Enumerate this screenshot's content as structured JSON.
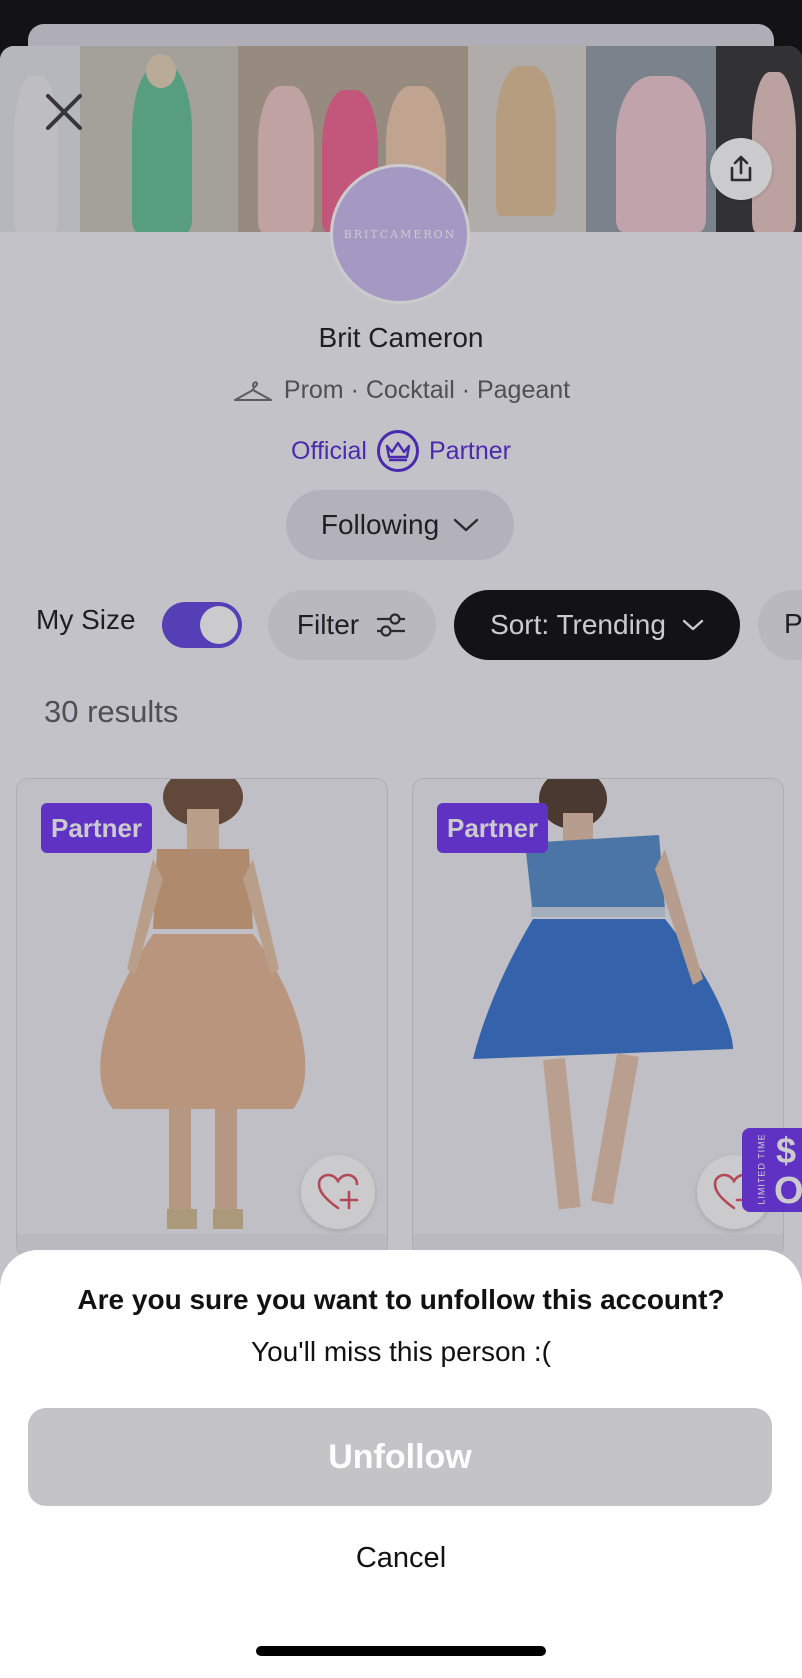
{
  "header": {
    "close_icon": "close-icon",
    "share_icon": "share-icon"
  },
  "profile": {
    "avatar_text": "BRITCAMERON",
    "avatar_color": "#cbb9f0",
    "name": "Brit Cameron",
    "categories": "Prom · Cocktail · Pageant",
    "hanger_icon": "hanger-icon",
    "official_label": "Official",
    "partner_label": "Partner",
    "crown_icon": "crown-icon",
    "accent_color": "#4b1fd1",
    "following_label": "Following"
  },
  "filters": {
    "my_size_label": "My Size",
    "my_size_on": true,
    "filter_label": "Filter",
    "sort_label": "Sort: Trending",
    "price_label": "Pr"
  },
  "results": {
    "count_label": "30 results"
  },
  "products": [
    {
      "badge": "Partner",
      "dress_color": "#e5b48e"
    },
    {
      "badge": "Partner",
      "dress_color": "#2f6fd0"
    }
  ],
  "promo": {
    "limited": "LIMITED TIME",
    "dollar": "$",
    "zero": "O"
  },
  "dialog": {
    "title": "Are you sure you want to unfollow this account?",
    "subtitle": "You'll miss this person :(",
    "unfollow_label": "Unfollow",
    "cancel_label": "Cancel"
  }
}
